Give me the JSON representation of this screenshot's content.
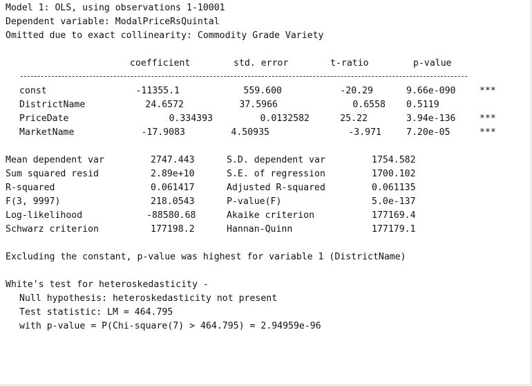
{
  "header": {
    "model_line": "Model 1: OLS, using observations 1-10001",
    "dependent_line": "Dependent variable: ModalPriceRsQuintal",
    "omitted_line": "Omitted due to exact collinearity: Commodity Grade Variety"
  },
  "table": {
    "columns": [
      "coefficient",
      "std. error",
      "t-ratio",
      "p-value"
    ],
    "rows": [
      {
        "name": "const",
        "coef": "-11355.1",
        "se": "559.600",
        "t": "-20.29",
        "p": "9.66e-090",
        "stars": "***"
      },
      {
        "name": "DistrictName",
        "coef": "24.6572",
        "se": "37.5966",
        "t": "0.6558",
        "p": "0.5119",
        "stars": ""
      },
      {
        "name": "PriceDate",
        "coef": "0.334393",
        "se": "0.0132582",
        "t": "25.22",
        "p": "3.94e-136",
        "stars": "***"
      },
      {
        "name": "MarketName",
        "coef": "-17.9083",
        "se": "4.50935",
        "t": "-3.971",
        "p": "7.20e-05",
        "stars": "***"
      }
    ]
  },
  "stats": [
    {
      "l1": "Mean dependent var",
      "v1": "2747.443",
      "l2": "S.D. dependent var",
      "v2": "1754.582"
    },
    {
      "l1": "Sum squared resid",
      "v1": "2.89e+10",
      "l2": "S.E. of regression",
      "v2": "1700.102"
    },
    {
      "l1": "R-squared",
      "v1": "0.061417",
      "l2": "Adjusted R-squared",
      "v2": "0.061135"
    },
    {
      "l1": "F(3, 9997)",
      "v1": "218.0543",
      "l2": "P-value(F)",
      "v2": "5.0e-137"
    },
    {
      "l1": "Log-likelihood",
      "v1": "-88580.68",
      "l2": "Akaike criterion",
      "v2": "177169.4"
    },
    {
      "l1": "Schwarz criterion",
      "v1": "177198.2",
      "l2": "Hannan-Quinn",
      "v2": "177179.1"
    }
  ],
  "note": "Excluding the constant, p-value was highest for variable 1 (DistrictName)",
  "white_test": {
    "title": "White's test for heteroskedasticity -",
    "null": "Null hypothesis: heteroskedasticity not present",
    "statistic": "Test statistic: LM = 464.795",
    "pvalue": "with p-value = P(Chi-square(7) > 464.795) = 2.94959e-96"
  }
}
